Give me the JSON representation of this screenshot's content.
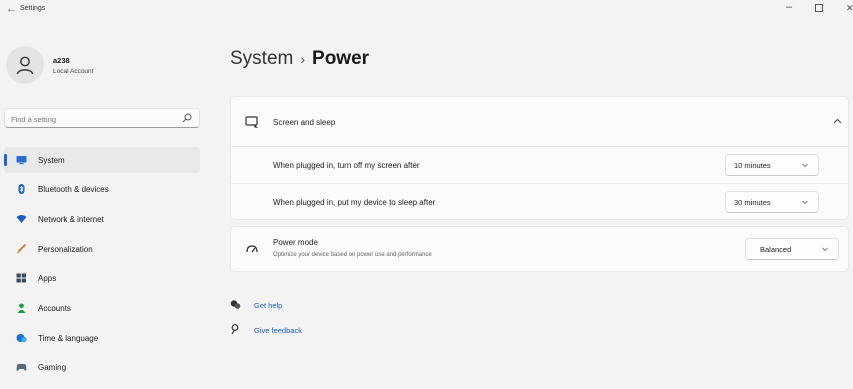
{
  "window": {
    "back_icon": "back-arrow-icon",
    "title": "Settings",
    "controls": [
      "minimize-icon",
      "maximize-icon",
      "close-icon"
    ]
  },
  "profile": {
    "name": "a238",
    "account_type": "Local Account"
  },
  "search": {
    "placeholder": "Find a setting"
  },
  "sidebar": {
    "items": [
      {
        "label": "System",
        "icon": "monitor-icon",
        "active": true
      },
      {
        "label": "Bluetooth & devices",
        "icon": "bluetooth-icon",
        "active": false
      },
      {
        "label": "Network & internet",
        "icon": "wifi-icon",
        "active": false
      },
      {
        "label": "Personalization",
        "icon": "brush-icon",
        "active": false
      },
      {
        "label": "Apps",
        "icon": "apps-icon",
        "active": false
      },
      {
        "label": "Accounts",
        "icon": "person-icon",
        "active": false
      },
      {
        "label": "Time & language",
        "icon": "globe-clock-icon",
        "active": false
      },
      {
        "label": "Gaming",
        "icon": "gamepad-icon",
        "active": false
      }
    ]
  },
  "header": {
    "breadcrumb": "System",
    "separator": "›",
    "title": "Power"
  },
  "screen_sleep": {
    "title": "Screen and sleep",
    "expanded": true,
    "rows": [
      {
        "label": "When plugged in, turn off my screen after",
        "value": "10 minutes"
      },
      {
        "label": "When plugged in, put my device to sleep after",
        "value": "30 minutes"
      }
    ]
  },
  "power_mode": {
    "title": "Power mode",
    "description": "Optimize your device based on power use and performance",
    "value": "Balanced"
  },
  "links": {
    "help": "Get help",
    "feedback": "Give feedback"
  },
  "colors": {
    "accent": "#1a66cc",
    "link": "#1a5fb4",
    "background": "#f3f3f3",
    "card": "#fbfbfb"
  }
}
